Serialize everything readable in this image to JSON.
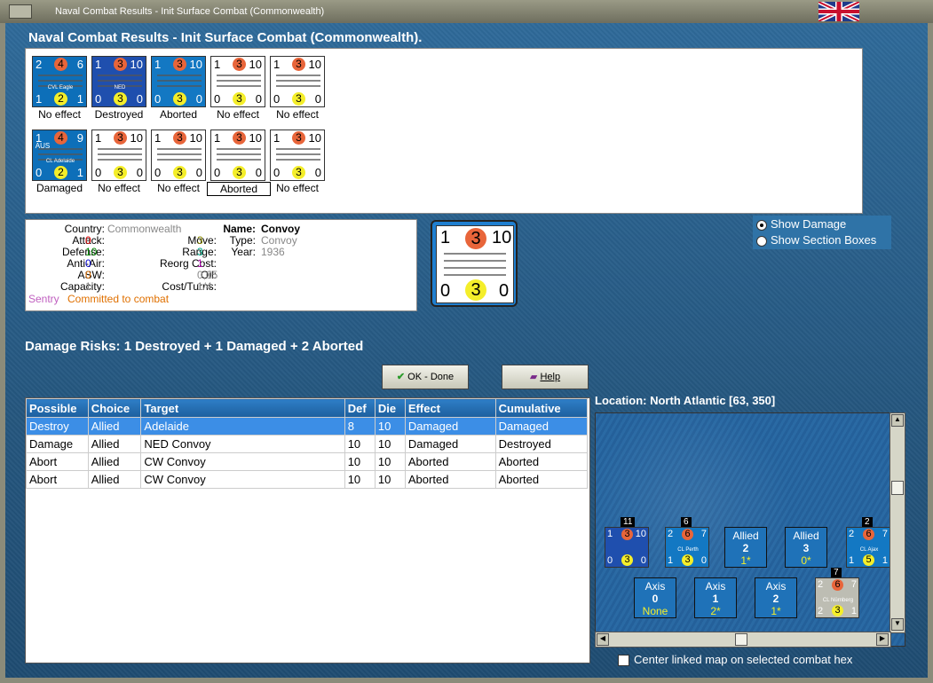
{
  "window": {
    "title": "Naval Combat Results - Init Surface Combat (Commonwealth)"
  },
  "header": {
    "title": "Naval Combat Results - Init Surface Combat (Commonwealth)."
  },
  "counters_row1": [
    {
      "top": "2",
      "mid": "4",
      "right": "6",
      "name": "CVL Eagle",
      "b1": "1",
      "b2": "2",
      "b3": "1",
      "label": "No effect"
    },
    {
      "top": "1",
      "mid": "3",
      "right": "10",
      "name": "NED",
      "b1": "0",
      "b2": "3",
      "b3": "0",
      "label": "Destroyed"
    },
    {
      "top": "1",
      "mid": "3",
      "right": "10",
      "name": "",
      "b1": "0",
      "b2": "3",
      "b3": "0",
      "label": "Aborted"
    },
    {
      "top": "1",
      "mid": "3",
      "right": "10",
      "name": "",
      "b1": "0",
      "b2": "3",
      "b3": "0",
      "label": "No effect"
    },
    {
      "top": "1",
      "mid": "3",
      "right": "10",
      "name": "",
      "b1": "0",
      "b2": "3",
      "b3": "0",
      "label": "No effect"
    }
  ],
  "counters_row2": [
    {
      "top": "1",
      "mid": "4",
      "right": "9",
      "name": "CL Adelaide",
      "tag": "AUS",
      "b1": "0",
      "b2": "2",
      "b3": "1",
      "label": "Damaged"
    },
    {
      "top": "1",
      "mid": "3",
      "right": "10",
      "name": "",
      "b1": "0",
      "b2": "3",
      "b3": "0",
      "label": "No effect"
    },
    {
      "top": "1",
      "mid": "3",
      "right": "10",
      "name": "",
      "b1": "0",
      "b2": "3",
      "b3": "0",
      "label": "No effect"
    },
    {
      "top": "1",
      "mid": "3",
      "right": "10",
      "name": "",
      "b1": "0",
      "b2": "3",
      "b3": "0",
      "label": "Aborted"
    },
    {
      "top": "1",
      "mid": "3",
      "right": "10",
      "name": "",
      "b1": "0",
      "b2": "3",
      "b3": "0",
      "label": "No effect"
    }
  ],
  "info": {
    "country_label": "Country:",
    "country": "Commonwealth",
    "attack_label": "Attack:",
    "attack": "0",
    "defense_label": "Defense:",
    "defense": "10",
    "antiair_label": "Anti-Air:",
    "antiair": "0",
    "asw_label": "ASW:",
    "asw": "0",
    "capacity_label": "Capacity:",
    "capacity": "1",
    "move_label": "Move:",
    "move": "3",
    "range_label": "Range:",
    "range": "3",
    "reorg_label": "Reorg Cost:",
    "reorg": "1",
    "oil_label": "Oil:",
    "oil": "0,05",
    "cost_label": "Cost/Turns:",
    "cost": "1/4",
    "name_label": "Name:",
    "name": "Convoy",
    "type_label": "Type:",
    "type": "Convoy",
    "year_label": "Year:",
    "year": "1936",
    "sentry": "Sentry",
    "status": "Committed to combat"
  },
  "big_counter": {
    "top": "1",
    "mid": "3",
    "right": "10",
    "b1": "0",
    "b2": "3",
    "b3": "0"
  },
  "options": {
    "show_damage": "Show Damage",
    "show_section": "Show Section Boxes"
  },
  "damage_risks": "Damage Risks: 1 Destroyed + 1 Damaged + 2 Aborted",
  "buttons": {
    "ok": "OK - Done",
    "help": "Help"
  },
  "table": {
    "headers": [
      "Possible",
      "Choice",
      "Target",
      "Def",
      "Die",
      "Effect",
      "Cumulative"
    ],
    "rows": [
      [
        "Destroy",
        "Allied",
        "Adelaide",
        "8",
        "10",
        "Damaged",
        "Damaged"
      ],
      [
        "Damage",
        "Allied",
        "NED Convoy",
        "10",
        "10",
        "Damaged",
        "Destroyed"
      ],
      [
        "Abort",
        "Allied",
        "CW Convoy",
        "10",
        "10",
        "Aborted",
        "Aborted"
      ],
      [
        "Abort",
        "Allied",
        "CW Convoy",
        "10",
        "10",
        "Aborted",
        "Aborted"
      ]
    ]
  },
  "location": "Location:  North Atlantic [63, 350]",
  "map": {
    "allied_counter1": {
      "stack": "11",
      "top": "1",
      "mid": "3",
      "right": "10",
      "b1": "0",
      "b2": "3",
      "b3": "0"
    },
    "allied_counter2": {
      "stack": "6",
      "top": "2",
      "mid": "6",
      "right": "7",
      "name": "CL Perth",
      "b1": "1",
      "b2": "3",
      "b3": "0"
    },
    "allied_box1": {
      "title": "Allied",
      "n": "2",
      "y": "1*"
    },
    "allied_box2": {
      "title": "Allied",
      "n": "3",
      "y": "0*"
    },
    "allied_counter3": {
      "stack": "2",
      "top": "2",
      "mid": "6",
      "right": "7",
      "name": "CL Ajax",
      "b1": "1",
      "b2": "5",
      "b3": "1"
    },
    "axis_box1": {
      "title": "Axis",
      "n": "0",
      "y": "None"
    },
    "axis_box2": {
      "title": "Axis",
      "n": "1",
      "y": "2*"
    },
    "axis_box3": {
      "title": "Axis",
      "n": "2",
      "y": "1*"
    },
    "axis_counter": {
      "stack": "7",
      "top": "2",
      "mid": "6",
      "right": "7",
      "name": "CL Nürnberg",
      "b1": "2",
      "b2": "3",
      "b3": "1"
    }
  },
  "center_map": "Center linked map on selected combat hex"
}
